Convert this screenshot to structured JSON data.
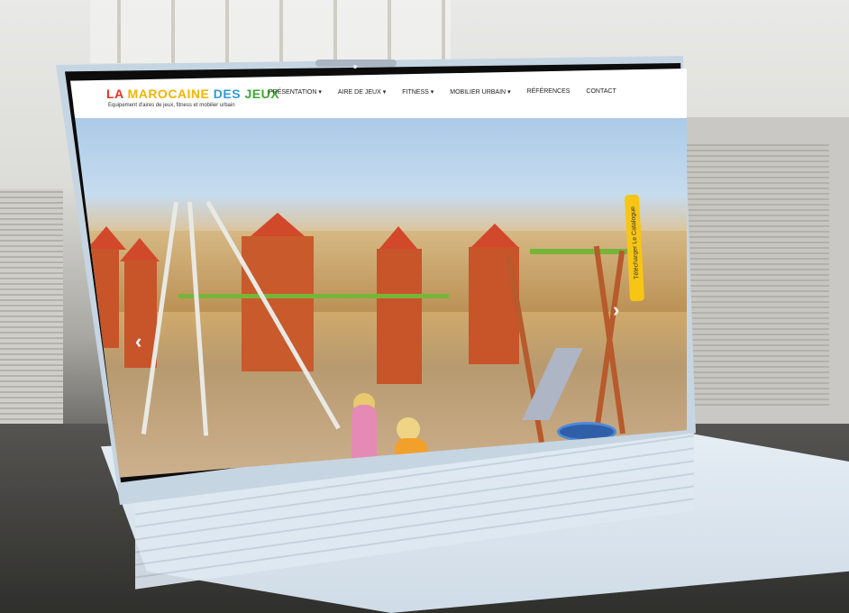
{
  "site": {
    "logo_words": [
      "LA",
      "MAROCAINE",
      "DES",
      "JEUX"
    ],
    "tagline": "Equipement d'aires de jeux, fitness et mobilier urbain",
    "nav": [
      {
        "label": "PRÉSENTATION",
        "has_dropdown": true
      },
      {
        "label": "AIRE DE JEUX",
        "has_dropdown": true
      },
      {
        "label": "FITNESS",
        "has_dropdown": true
      },
      {
        "label": "MOBILIER URBAIN",
        "has_dropdown": true
      },
      {
        "label": "RÉFÉRENCES",
        "has_dropdown": false
      },
      {
        "label": "CONTACT",
        "has_dropdown": false
      }
    ],
    "catalog_button": "Télécharger Le Catalogue",
    "dropdown_caret": "▾",
    "prev_arrow": "‹",
    "next_arrow": "›",
    "catalog_icon": "download-icon"
  },
  "colors": {
    "logo": [
      "#e63323",
      "#f4b400",
      "#2e9bd6",
      "#3ba935"
    ],
    "catalog_bg": "#f6c515"
  }
}
